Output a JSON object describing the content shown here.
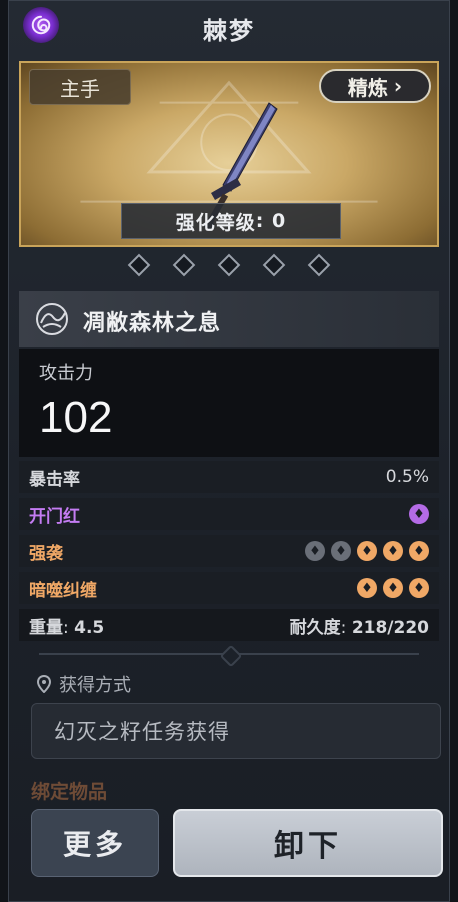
{
  "header": {
    "title": "棘梦",
    "rarity_icon": "swirl-icon",
    "rarity_color": "#9b4de8"
  },
  "weapon": {
    "slot_tag": "主手",
    "refine_label": "精炼",
    "enhance_label": "强化等级",
    "enhance_level": "0",
    "gem_slots": 5
  },
  "item": {
    "name": "凋敝森林之息",
    "attack_label": "攻击力",
    "attack_value": "102"
  },
  "stats": {
    "crit": {
      "label": "暴击率",
      "value": "0.5%"
    },
    "perk1": {
      "label": "开门红",
      "pips_on": 1,
      "pips_total": 1
    },
    "perk2": {
      "label": "强袭",
      "pips_on": 3,
      "pips_total": 5
    },
    "perk3": {
      "label": "暗噬纠缠",
      "pips_on": 3,
      "pips_total": 3
    },
    "weight_label": "重量",
    "weight_value": "4.5",
    "durability_label": "耐久度",
    "durability_value": "218/220"
  },
  "source": {
    "title": "获得方式",
    "value": "幻灭之籽任务获得"
  },
  "bound_label": "绑定物品",
  "buttons": {
    "more": "更多",
    "unequip": "卸下"
  },
  "colors": {
    "perk_purple": "#c47cf2",
    "perk_orange": "#f0a866",
    "card_gold": "#caa866"
  }
}
